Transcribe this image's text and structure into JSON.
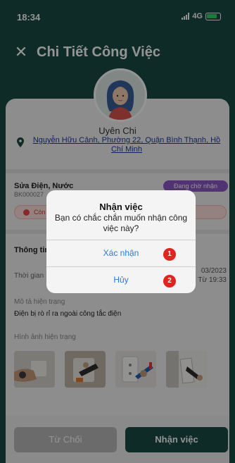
{
  "status_bar": {
    "time": "18:34",
    "network": "4G"
  },
  "header": {
    "title": "Chi Tiết Công Việc"
  },
  "user": {
    "name": "Uyên Chi",
    "address": "Nguyễn Hữu Cảnh, Phường 22, Quận Bình Thạnh, Hồ Chí Minh"
  },
  "job": {
    "name": "Sửa Điện, Nước",
    "code": "BK000027",
    "status": "Đang chờ nhận",
    "warning": "Còn"
  },
  "info": {
    "section_title": "Thông tin",
    "time_label": "Thời gian",
    "time_value_date": "03/2023",
    "time_value_time": "Từ 19:33"
  },
  "description": {
    "label": "Mô tả hiện trạng",
    "value": "Điện bị rò rỉ ra ngoài công tắc điện"
  },
  "images": {
    "label": "Hình ảnh hiện trạng"
  },
  "footer": {
    "reject_label": "Từ Chối",
    "accept_label": "Nhận việc"
  },
  "dialog": {
    "title": "Nhận việc",
    "message": "Bạn có chắc chắn muốn nhận công việc này?",
    "confirm_label": "Xác nhận",
    "cancel_label": "Hủy",
    "step_1": "1",
    "step_2": "2"
  },
  "colors": {
    "primary": "#1b4a44",
    "status_badge": "#8c59c9",
    "step_badge": "#e0241f",
    "link": "#2a7bd8"
  }
}
